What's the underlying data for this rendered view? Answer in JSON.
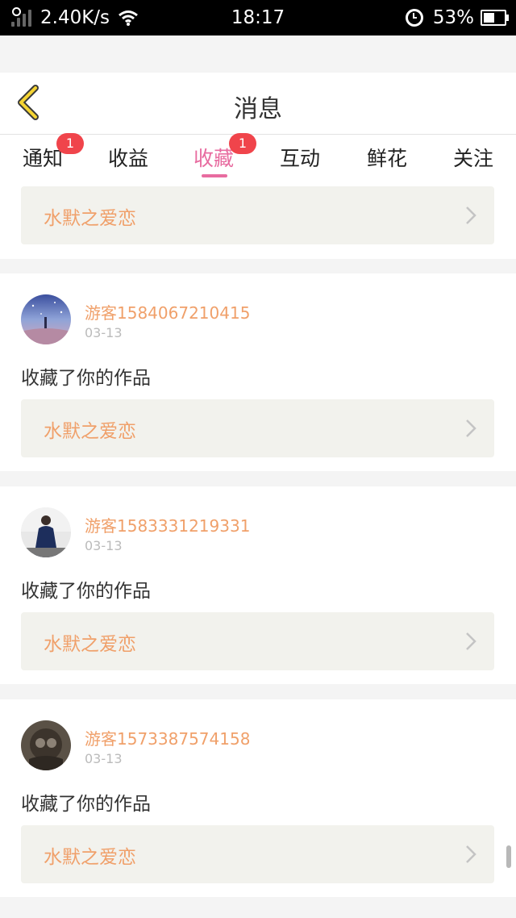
{
  "status_bar": {
    "speed": "2.40K/s",
    "time": "18:17",
    "battery": "53%",
    "battery_level": 0.53
  },
  "header": {
    "title": "消息"
  },
  "tabs": [
    {
      "label": "通知",
      "badge": "1"
    },
    {
      "label": "收益",
      "badge": ""
    },
    {
      "label": "收藏",
      "badge": "1",
      "active": true
    },
    {
      "label": "互动",
      "badge": ""
    },
    {
      "label": "鲜花",
      "badge": ""
    },
    {
      "label": "关注",
      "badge": ""
    }
  ],
  "top_card": {
    "work_title": "水默之爱恋"
  },
  "messages": [
    {
      "username": "游客1584067210415",
      "date": "03-13",
      "text": "收藏了你的作品",
      "work_title": "水默之爱恋"
    },
    {
      "username": "游客1583331219331",
      "date": "03-13",
      "text": "收藏了你的作品",
      "work_title": "水默之爱恋"
    },
    {
      "username": "游客1573387574158",
      "date": "03-13",
      "text": "收藏了你的作品",
      "work_title": "水默之爱恋"
    }
  ],
  "colors": {
    "accent": "#e86ca0",
    "link_text": "#f0a06a",
    "badge": "#f0444b"
  }
}
